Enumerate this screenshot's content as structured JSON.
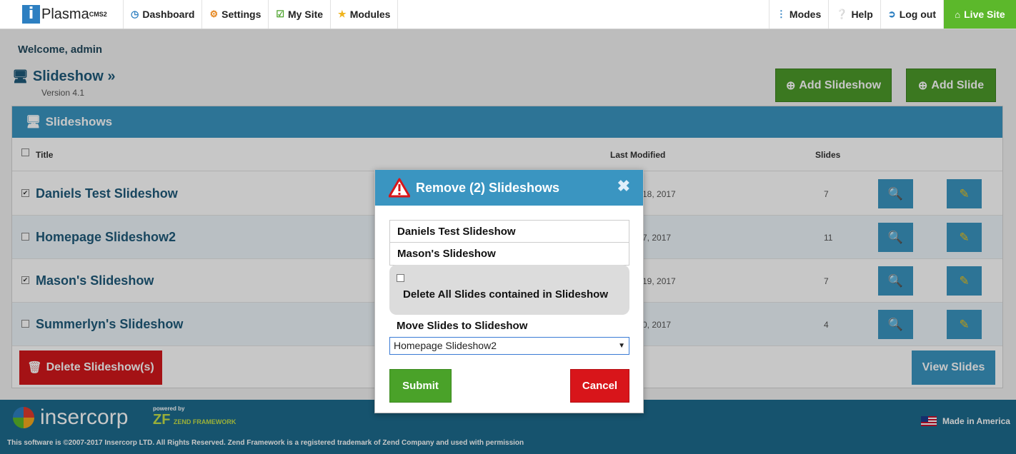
{
  "nav": {
    "brand": "Plasma",
    "brand_sup": "CMS2",
    "left_items": [
      {
        "label": "Dashboard",
        "icon": "dashboard-icon"
      },
      {
        "label": "Settings",
        "icon": "gear-icon"
      },
      {
        "label": "My Site",
        "icon": "edit-check-icon"
      },
      {
        "label": "Modules",
        "icon": "star-icon"
      }
    ],
    "right_items": [
      {
        "label": "Modes",
        "icon": "vertical-dots-icon"
      },
      {
        "label": "Help",
        "icon": "help-icon"
      },
      {
        "label": "Log out",
        "icon": "logout-icon"
      },
      {
        "label": "Live Site",
        "icon": "home-icon"
      }
    ]
  },
  "page": {
    "welcome": "Welcome, admin",
    "title": "Slideshow »",
    "version": "Version 4.1",
    "add_slideshow": "Add Slideshow",
    "add_slide": "Add Slide"
  },
  "panel": {
    "title": "Slideshows",
    "col_title": "Title",
    "col_modified": "Last Modified",
    "col_slides": "Slides",
    "rows": [
      {
        "title": "Daniels Test Slideshow",
        "date": "18, 2017",
        "slides": "7",
        "checked": true
      },
      {
        "title": "Homepage Slideshow2",
        "date": "7, 2017",
        "slides": "11",
        "checked": false
      },
      {
        "title": "Mason's Slideshow",
        "date": "19, 2017",
        "slides": "7",
        "checked": true
      },
      {
        "title": "Summerlyn's Slideshow",
        "date": "0, 2017",
        "slides": "4",
        "checked": false
      }
    ],
    "delete_button": "Delete Slideshow(s)",
    "view_button": "View Slides"
  },
  "footer": {
    "logo": "insercorp",
    "zend_powered": "powered by",
    "zend_big": "ZF",
    "zend_text": "ZEND FRAMEWORK",
    "made": "Made in America",
    "copyright": "This software is ©2007-2017 Insercorp LTD. All Rights Reserved. Zend Framework is a registered trademark of Zend Company and used with permission"
  },
  "modal": {
    "title": "Remove (2) Slideshows",
    "items": [
      "Daniels Test Slideshow",
      "Mason's Slideshow"
    ],
    "delete_all_label": "Delete All Slides contained in Slideshow",
    "delete_all_checked": false,
    "move_label": "Move Slides to Slideshow",
    "move_selected": "Homepage Slideshow2",
    "submit": "Submit",
    "cancel": "Cancel"
  },
  "colors": {
    "accent": "#3a95c1",
    "green": "#4aa229",
    "red": "#d8151a",
    "live_site": "#5cb82b"
  }
}
